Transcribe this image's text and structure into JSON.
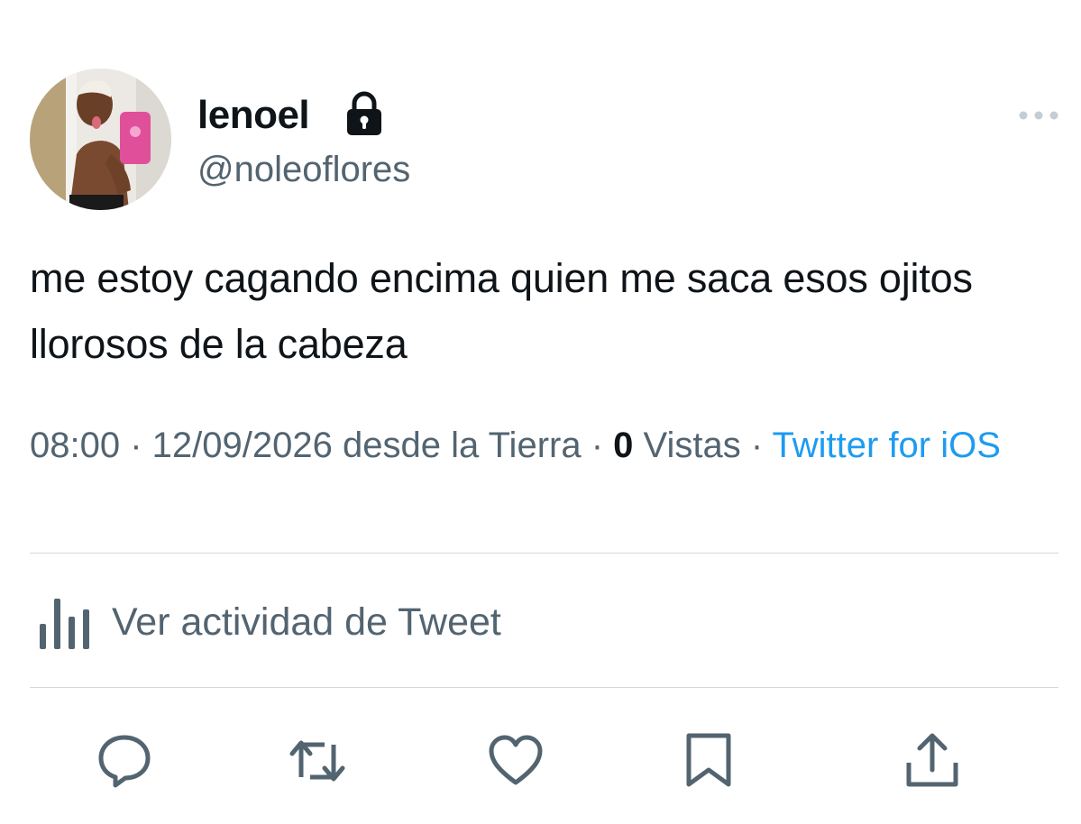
{
  "author": {
    "display_name": "lenoel",
    "handle": "@noleoflores",
    "protected_icon": "lock-icon",
    "avatar": "profile-photo"
  },
  "tweet": {
    "text": "me estoy cagando encima quien me saca esos ojitos llorosos de la cabeza"
  },
  "meta": {
    "time": "08:00",
    "separator": " · ",
    "date": "12/09/2026",
    "location": "desde la Tierra",
    "views_count": "0",
    "views_label": "Vistas",
    "source": "Twitter for iOS"
  },
  "activity": {
    "label": "Ver actividad de Tweet",
    "icon": "analytics-icon"
  },
  "actions": [
    {
      "name": "reply",
      "icon": "reply-icon"
    },
    {
      "name": "retweet",
      "icon": "retweet-icon"
    },
    {
      "name": "like",
      "icon": "heart-icon"
    },
    {
      "name": "bookmark",
      "icon": "bookmark-icon"
    },
    {
      "name": "share",
      "icon": "share-icon"
    }
  ],
  "colors": {
    "text": "#0f1419",
    "secondary": "#536471",
    "link": "#1d9bf0",
    "divider": "#cfd9de"
  }
}
